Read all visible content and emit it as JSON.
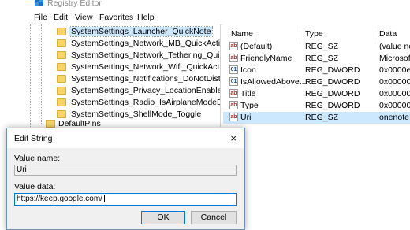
{
  "window": {
    "title": "Registry Editor",
    "menu": [
      "File",
      "Edit",
      "View",
      "Favorites",
      "Help"
    ]
  },
  "tree": {
    "items": [
      {
        "label": "SystemSettings_Launcher_QuickNote",
        "selected": true
      },
      {
        "label": "SystemSettings_Network_MB_QuickAction"
      },
      {
        "label": "SystemSettings_Network_Tethering_QuickA"
      },
      {
        "label": "SystemSettings_Network_Wifi_QuickAction"
      },
      {
        "label": "SystemSettings_Notifications_DoNotDisturl"
      },
      {
        "label": "SystemSettings_Privacy_LocationEnabledUs"
      },
      {
        "label": "SystemSettings_Radio_IsAirplaneModeEnab"
      },
      {
        "label": "SystemSettings_ShellMode_Toggle"
      }
    ],
    "below": [
      "DefaultPins"
    ]
  },
  "list": {
    "headers": [
      "Name",
      "Type",
      "Data"
    ],
    "rows": [
      {
        "icon": "ab",
        "name": "(Default)",
        "type": "REG_SZ",
        "data": "(value no"
      },
      {
        "icon": "ab",
        "name": "FriendlyName",
        "type": "REG_SZ",
        "data": "Microsoft"
      },
      {
        "icon": "dw",
        "name": "Icon",
        "type": "REG_DWORD",
        "data": "0x0000e70"
      },
      {
        "icon": "dw",
        "name": "IsAllowedAbove...",
        "type": "REG_DWORD",
        "data": "0x0000000"
      },
      {
        "icon": "ab",
        "name": "Title",
        "type": "REG_DWORD",
        "data": "0x000000"
      },
      {
        "icon": "ab",
        "name": "Type",
        "type": "REG_DWORD",
        "data": "0x0000000"
      },
      {
        "icon": "ab",
        "name": "Uri",
        "type": "REG_SZ",
        "data": "onenote:A",
        "selected": true
      }
    ]
  },
  "dialog": {
    "title": "Edit String",
    "close_label": "×",
    "value_name_label": "Value name:",
    "value_name": "Uri",
    "value_data_label": "Value data:",
    "value_data": "https://keep.google.com/",
    "ok_label": "OK",
    "cancel_label": "Cancel"
  },
  "colors": {
    "selection": "#cce8ff",
    "focus_border": "#0078d7",
    "folder": "#f5d56a"
  }
}
